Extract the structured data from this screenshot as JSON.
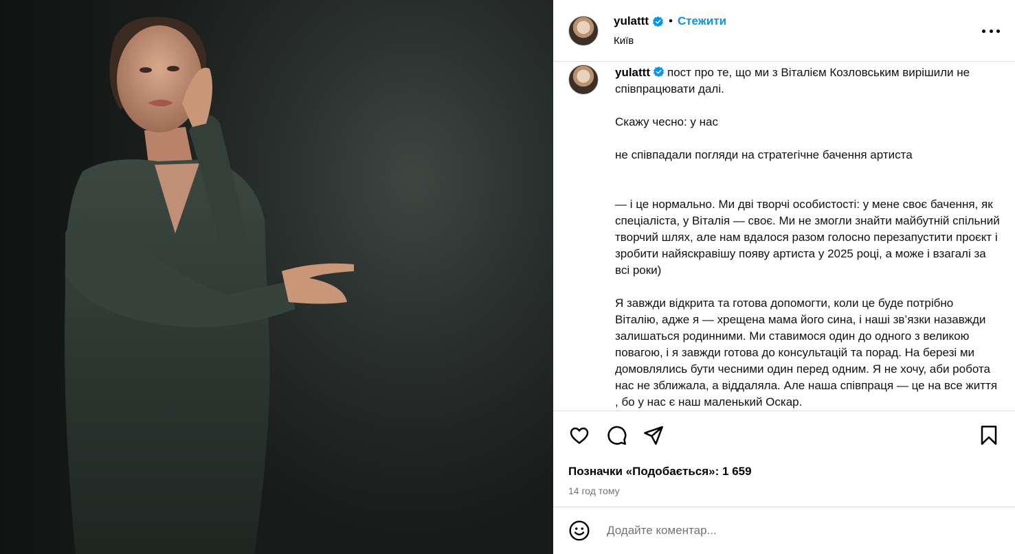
{
  "post": {
    "username": "yulattt",
    "follow_label": "Стежити",
    "location": "Київ",
    "caption": "пост про те, що ми з Віталієм Козловським вирішили не співпрацювати далі.\n\nСкажу чесно: у нас\n\nне співпадали погляди на стратегічне бачення артиста\n\n\n— і це нормально. Ми дві творчі особистості: у мене своє бачення, як спеціаліста, у Віталія — своє. Ми не змогли знайти майбутній спільний творчий шлях, але нам вдалося разом голосно перезапустити проєкт і зробити найяскравішу появу артиста у 2025 році, а може і взагалі за всі роки)\n\nЯ завжди відкрита та готова допомогти, коли це буде потрібно Віталію, адже я — хрещена мама його сина, і наші зв’язки назавжди залишаться родинними. Ми ставимося один до одного з великою повагою, і я завжди готова до консультацій та порад. На березі ми домовлялись бути чесними один перед одним. Я не хочу, аби робота нас не зближала, а віддаляла. Але наша співпраця — це на все життя , бо у нас є наш маленький Оскар.",
    "likes_text": "Позначки «Подобається»: 1 659",
    "time_ago": "14 год тому",
    "comment_placeholder": "Додайте коментар..."
  },
  "icons": {
    "verified": "verified-badge-icon",
    "more": "more-options-icon",
    "like": "heart-icon",
    "comment": "comment-icon",
    "share": "share-icon",
    "save": "bookmark-icon",
    "emoji": "emoji-icon"
  },
  "colors": {
    "link": "#0095f6",
    "verified": "#0095f6",
    "muted": "#737373",
    "border": "#dbdbdb"
  }
}
